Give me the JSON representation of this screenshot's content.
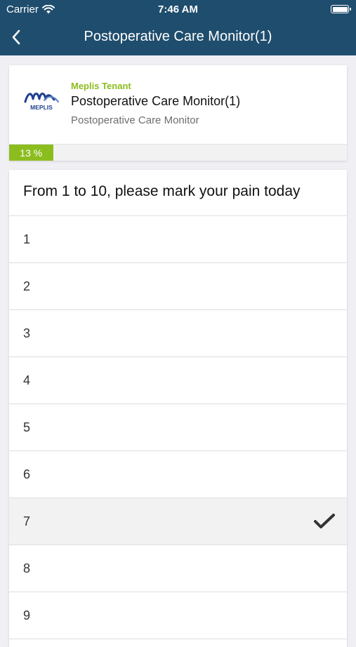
{
  "status_bar": {
    "carrier": "Carrier",
    "time": "7:46 AM",
    "icons": [
      "wifi-icon",
      "battery-icon"
    ]
  },
  "nav": {
    "title": "Postoperative Care Monitor(1)",
    "back_icon": "chevron-left-icon"
  },
  "survey": {
    "tenant": "Meplis Tenant",
    "title": "Postoperative Care Monitor(1)",
    "subtitle": "Postoperative Care Monitor",
    "logo_text": "MEPLIS",
    "progress_label": "13 %",
    "progress_fraction": 0.13
  },
  "question": {
    "text": "From 1 to 10, please mark your pain today",
    "options": [
      "1",
      "2",
      "3",
      "4",
      "5",
      "6",
      "7",
      "8",
      "9"
    ],
    "selected": "7",
    "check_icon": "checkmark-icon"
  },
  "colors": {
    "nav_background": "#1f4d6d",
    "accent_green": "#8cbd1f",
    "logo_blue": "#1f3f8f",
    "selected_row": "#f2f2f2"
  }
}
